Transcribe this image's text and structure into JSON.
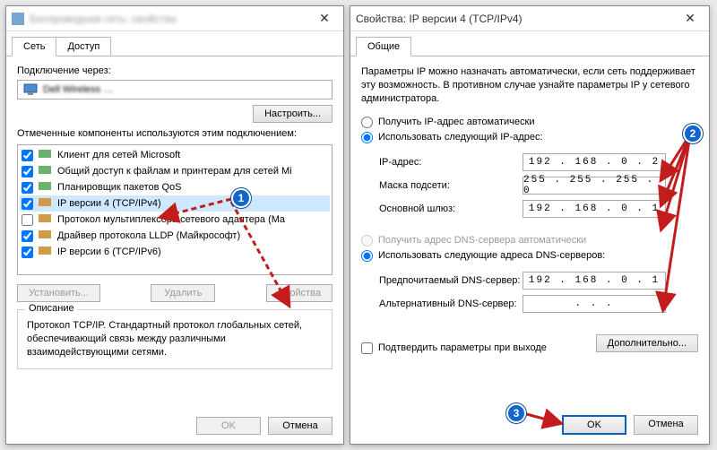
{
  "left": {
    "title_blurred": "Беспроводная сеть: свойства",
    "tabs": [
      "Сеть",
      "Доступ"
    ],
    "connect_via_label": "Подключение через:",
    "adapter_text": "Dell Wireless …",
    "configure_btn": "Настроить...",
    "components_label": "Отмеченные компоненты используются этим подключением:",
    "components": [
      {
        "label": "Клиент для сетей Microsoft",
        "checked": true
      },
      {
        "label": "Общий доступ к файлам и принтерам для сетей Mi",
        "checked": true
      },
      {
        "label": "Планировщик пакетов QoS",
        "checked": true
      },
      {
        "label": "IP версии 4 (TCP/IPv4)",
        "checked": true,
        "selected": true
      },
      {
        "label": "Протокол мультиплексора сетевого адаптера (Ma",
        "checked": false
      },
      {
        "label": "Драйвер протокола LLDP (Майкрософт)",
        "checked": true
      },
      {
        "label": "IP версии 6 (TCP/IPv6)",
        "checked": true
      }
    ],
    "install_btn": "Установить...",
    "uninstall_btn": "Удалить",
    "properties_btn": "Свойства",
    "description_title": "Описание",
    "description_text": "Протокол TCP/IP. Стандартный протокол глобальных сетей, обеспечивающий связь между различными взаимодействующими сетями.",
    "ok_btn": "OK",
    "cancel_btn": "Отмена"
  },
  "right": {
    "title": "Свойства: IP версии 4 (TCP/IPv4)",
    "tab": "Общие",
    "help": "Параметры IP можно назначать автоматически, если сеть поддерживает эту возможность. В противном случае узнайте параметры IP у сетевого администратора.",
    "ip_auto": "Получить IP-адрес автоматически",
    "ip_manual": "Использовать следующий IP-адрес:",
    "ip_label": "IP-адрес:",
    "ip_value": "192 . 168 .  0  .  2",
    "mask_label": "Маска подсети:",
    "mask_value": "255 . 255 . 255 .  0",
    "gw_label": "Основной шлюз:",
    "gw_value": "192 . 168 .  0  .  1",
    "dns_auto": "Получить адрес DNS-сервера автоматически",
    "dns_manual": "Использовать следующие адреса DNS-серверов:",
    "dns_pref_label": "Предпочитаемый DNS-сервер:",
    "dns_pref_value": "192 . 168 .  0  .  1",
    "dns_alt_label": "Альтернативный DNS-сервер:",
    "dns_alt_value": ".      .      .",
    "confirm_on_exit": "Подтвердить параметры при выходе",
    "advanced_btn": "Дополнительно...",
    "ok_btn": "OK",
    "cancel_btn": "Отмена"
  },
  "badges": {
    "b1": "1",
    "b2": "2",
    "b3": "3"
  }
}
